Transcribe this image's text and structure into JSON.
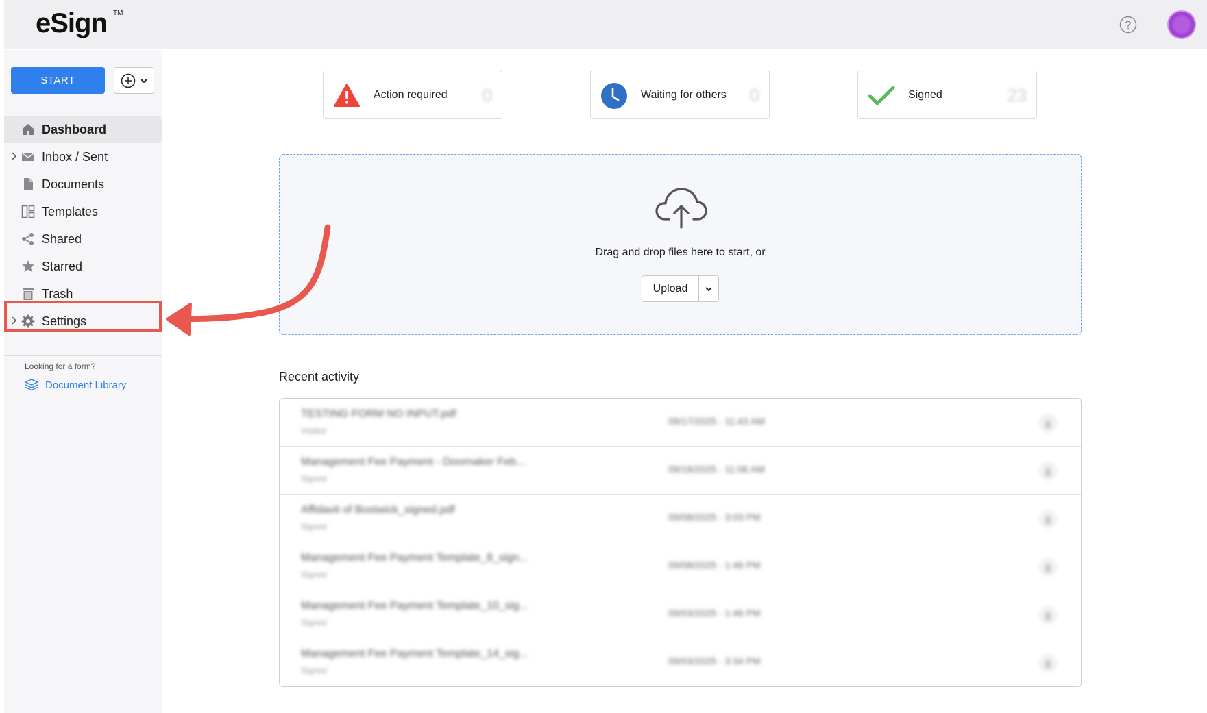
{
  "header": {
    "logo": "eSign",
    "logo_tm": "TM",
    "help_icon": "question-circle-icon",
    "avatar_color": "#b45be0"
  },
  "sidebar": {
    "start_label": "START",
    "add_icon": "plus-circle-icon",
    "items": [
      {
        "label": "Dashboard",
        "icon": "home-icon",
        "active": true,
        "expandable": false
      },
      {
        "label": "Inbox / Sent",
        "icon": "envelope-icon",
        "active": false,
        "expandable": true
      },
      {
        "label": "Documents",
        "icon": "document-icon",
        "active": false,
        "expandable": false
      },
      {
        "label": "Templates",
        "icon": "templates-icon",
        "active": false,
        "expandable": false
      },
      {
        "label": "Shared",
        "icon": "share-icon",
        "active": false,
        "expandable": false
      },
      {
        "label": "Starred",
        "icon": "star-icon",
        "active": false,
        "expandable": false
      },
      {
        "label": "Trash",
        "icon": "trash-icon",
        "active": false,
        "expandable": false
      },
      {
        "label": "Settings",
        "icon": "gear-icon",
        "active": false,
        "expandable": true,
        "highlighted": true
      }
    ],
    "form_hint": "Looking for a form?",
    "doc_library": "Document Library"
  },
  "status_cards": [
    {
      "label": "Action required",
      "count": "0",
      "icon": "warning-triangle-icon",
      "color": "#f0433a"
    },
    {
      "label": "Waiting for others",
      "count": "0",
      "icon": "clock-icon",
      "color": "#2f6fc7"
    },
    {
      "label": "Signed",
      "count": "23",
      "icon": "checkmark-icon",
      "color": "#5cb85c"
    }
  ],
  "dropzone": {
    "text": "Drag and drop files here to start, or",
    "upload_label": "Upload"
  },
  "recent": {
    "title": "Recent activity",
    "rows": [
      {
        "name": "TESTING FORM NO INPUT.pdf",
        "status": "Voided",
        "date": "09/17/2025 · 11:43 AM"
      },
      {
        "name": "Management Fee Payment - Doornaker Feb...",
        "status": "Signed",
        "date": "09/16/2025 · 11:06 AM"
      },
      {
        "name": "Affidavit of Bostwick_signed.pdf",
        "status": "Signed",
        "date": "09/08/2025 · 3:03 PM"
      },
      {
        "name": "Management Fee Payment Template_8_sign...",
        "status": "Signed",
        "date": "09/08/2025 · 1:46 PM"
      },
      {
        "name": "Management Fee Payment Template_10_sig...",
        "status": "Signed",
        "date": "09/03/2025 · 1:46 PM"
      },
      {
        "name": "Management Fee Payment Template_14_sig...",
        "status": "Signed",
        "date": "09/03/2025 · 3:34 PM"
      }
    ]
  },
  "colors": {
    "accent": "#2f80ed",
    "highlight": "#e8584f"
  }
}
